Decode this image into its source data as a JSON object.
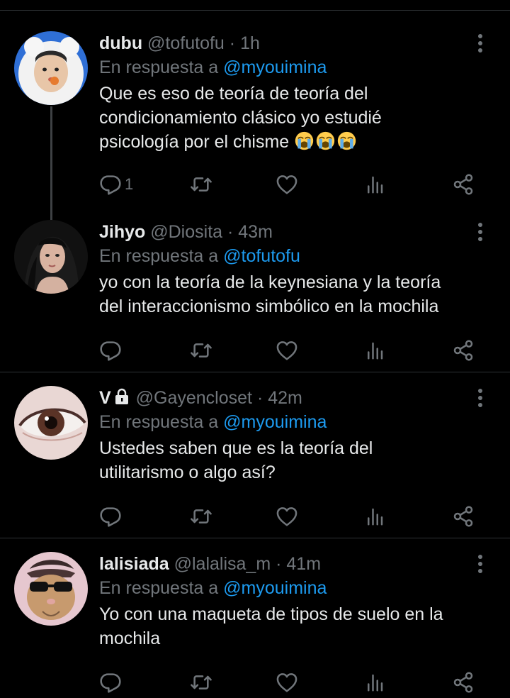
{
  "colors": {
    "background": "#000000",
    "text": "#e7e9ea",
    "muted": "#71767b",
    "mention": "#1d9bf0",
    "divider": "#2f3336"
  },
  "tweets": [
    {
      "name": "dubu",
      "handle": "@tofutofu",
      "separator": "·",
      "time": "1h",
      "reply_prefix": "En respuesta a",
      "reply_to": "@myouimina",
      "text": "Que es eso de teoría de teoría del\ncondicionamiento clásico yo estudié\npsicología por el chisme ",
      "emoji": [
        "loudly-crying-face",
        "loudly-crying-face",
        "loudly-crying-face"
      ],
      "reply_count": "1",
      "avatar": "girl-white-hood-avatar"
    },
    {
      "name": "Jihyo",
      "handle": "@Diosita",
      "separator": "·",
      "time": "43m",
      "reply_prefix": "En respuesta a",
      "reply_to": "@tofutofu",
      "text": "yo con la teoría de la keynesiana y la teoría\ndel interaccionismo simbólico en la mochila",
      "reply_count": "",
      "avatar": "dark-hair-portrait-avatar"
    },
    {
      "name": "V",
      "handle": "@Gayencloset",
      "separator": "·",
      "time": "42m",
      "reply_prefix": "En respuesta a",
      "reply_to": "@myouimina",
      "text": "Ustedes saben que es la teoría del\nutilitarismo o algo así?",
      "reply_count": "",
      "avatar": "eye-closeup-avatar",
      "protected_icon": "lock-icon"
    },
    {
      "name": "lalisiada",
      "handle": "@lalalisa_m",
      "separator": "·",
      "time": "41m",
      "reply_prefix": "En respuesta a",
      "reply_to": "@myouimina",
      "text": "Yo con una maqueta de tipos de suelo en la\nmochila",
      "reply_count": "",
      "avatar": "cat-sunglasses-avatar"
    }
  ]
}
